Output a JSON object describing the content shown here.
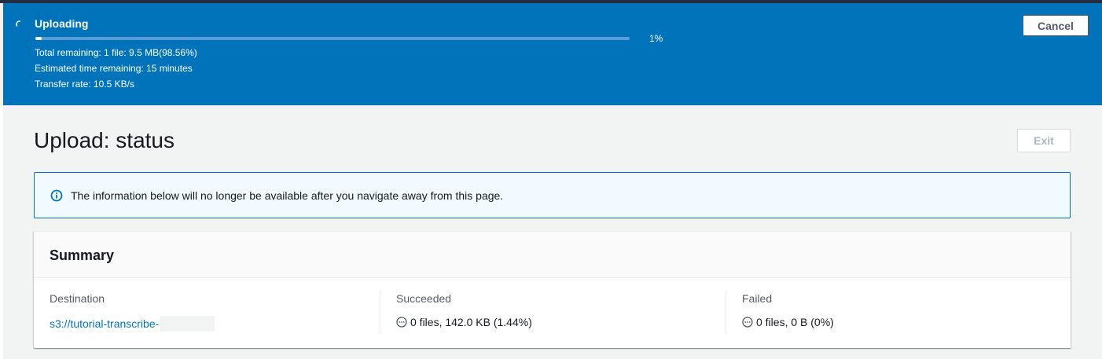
{
  "flashbar": {
    "title": "Uploading",
    "progress_fraction": 0.01,
    "progress_label": "1%",
    "total_remaining": "Total remaining: 1 file: 9.5 MB(98.56%)",
    "estimated_time": "Estimated time remaining: 15 minutes",
    "transfer_rate": "Transfer rate: 10.5 KB/s",
    "cancel_label": "Cancel",
    "background_color": "#0073bb"
  },
  "page": {
    "title": "Upload: status",
    "exit_label": "Exit"
  },
  "info_alert": {
    "icon": "info-icon",
    "text": "The information below will no longer be available after you navigate away from this page."
  },
  "summary": {
    "title": "Summary",
    "destination": {
      "label": "Destination",
      "value": "s3://tutorial-transcribe-"
    },
    "succeeded": {
      "label": "Succeeded",
      "icon": "pending-icon",
      "value": "0 files, 142.0 KB (1.44%)"
    },
    "failed": {
      "label": "Failed",
      "icon": "pending-icon",
      "value": "0 files, 0 B (0%)"
    }
  },
  "colors": {
    "accent": "#0073bb",
    "link": "#0073bb",
    "page_background": "#f2f3f3"
  }
}
